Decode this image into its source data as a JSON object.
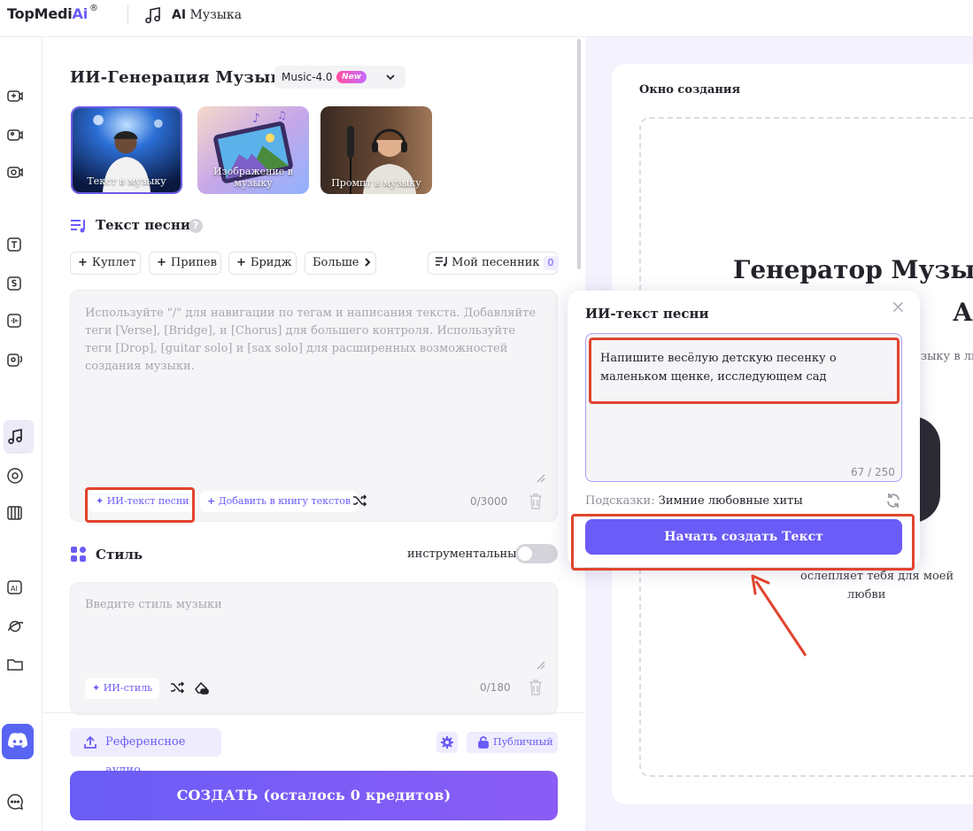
{
  "header": {
    "logo_main": "TopMedi",
    "logo_ai": "Ai",
    "logo_reg": "®",
    "app_title_ai": "AI",
    "app_title_rest": "Музыка"
  },
  "rail": {
    "items": [
      "video-plus-icon",
      "image-to-video-icon",
      "video-enhance-icon",
      "text-to-speech-icon",
      "speech-icon",
      "voice-changer-icon",
      "voice-clone-icon",
      "music-icon",
      "vinyl-icon",
      "piano-icon",
      "ai-chip-icon",
      "planet-icon",
      "folder-icon",
      "discord-icon",
      "chat-icon"
    ],
    "active": "music-icon"
  },
  "generator": {
    "title": "ИИ-Генерация Музыки",
    "model": "Music-4.0",
    "model_badge": "New",
    "modes": [
      {
        "label": "Текст в музыку",
        "selected": true
      },
      {
        "label": "Изображение в музыку",
        "selected": false
      },
      {
        "label": "Промпт в музыку",
        "selected": false
      }
    ]
  },
  "lyrics": {
    "heading": "Текст песни",
    "help": "?",
    "chips": {
      "verse": "Куплет",
      "chorus": "Припев",
      "bridge": "Бридж",
      "more": "Больше"
    },
    "songbook_label": "Мой песенник",
    "songbook_count": "0",
    "placeholder": "Используйте \"/\" для навигации по тегам и написания текста. Добавляйте теги [Verse], [Bridge], и [Chorus] для большего контроля. Используйте теги [Drop], [guitar solo] и [sax solo] для расширенных возможностей создания музыки.",
    "ai_lyrics_label": "ИИ-текст песни",
    "add_to_book_label": "Добавить в книгу текстов",
    "counter": "0/3000"
  },
  "style": {
    "heading": "Стиль",
    "instrumental_label": "инструментальный",
    "instrumental_on": false,
    "placeholder": "Введите стиль музыки",
    "ai_style_label": "ИИ-стиль",
    "counter": "0/180"
  },
  "footer": {
    "reference_audio": "Референсное аудио",
    "public_label": "Публичный",
    "create_label": "СОЗДАТЬ (осталось 0 кредитов)"
  },
  "create_window": {
    "title": "Окно создания",
    "hero_line1": "Генератор Музыки",
    "hero_line2": "А",
    "hero_sub": "зыку в люб",
    "card_line1": "ослепляет тебя для моей",
    "card_line2": "любви"
  },
  "popup": {
    "title": "ИИ-текст песни",
    "close": "×",
    "prompt_value": "Напишите весёлую детскую песенку о маленьком щенке, исследующем сад",
    "counter": "67 / 250",
    "hints_label": "Подсказки:",
    "hints_value": "Зимние любовные хиты",
    "start_label": "Начать создать Текст"
  },
  "colors": {
    "accent": "#6a5cf6",
    "highlight": "#e0442e",
    "right_bg": "#f4f2fd"
  }
}
